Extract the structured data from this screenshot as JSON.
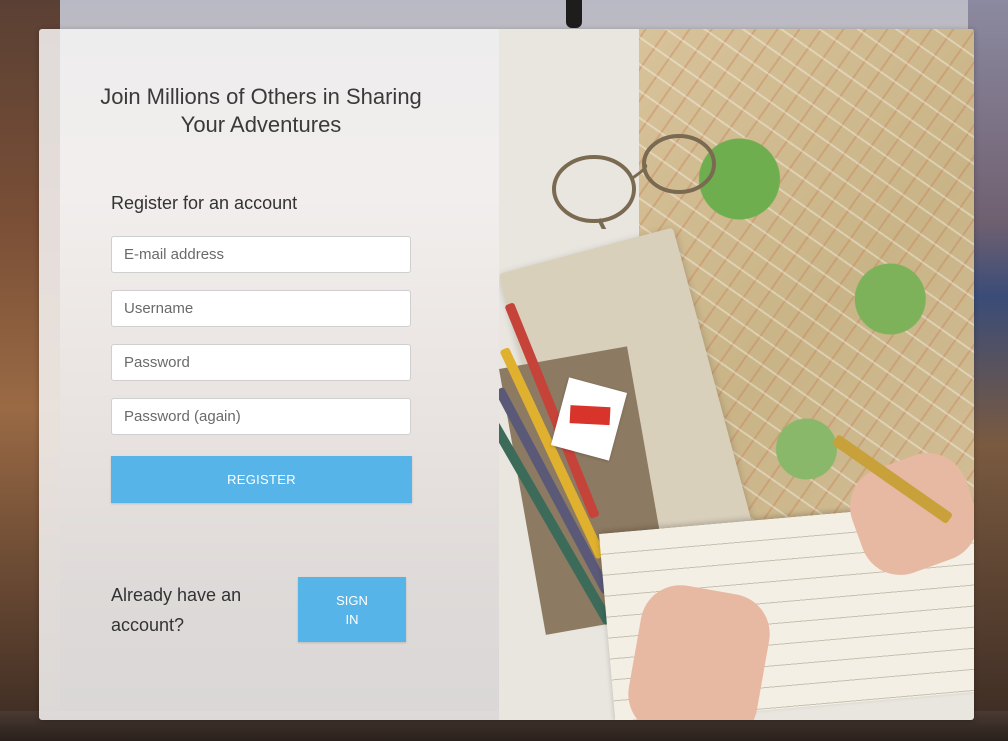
{
  "hero": {
    "headline": "Join Millions of Others in Sharing Your Adventures"
  },
  "register_form": {
    "title": "Register for an account",
    "email_placeholder": "E-mail address",
    "username_placeholder": "Username",
    "password_placeholder": "Password",
    "password_again_placeholder": "Password (again)",
    "register_label": "REGISTER"
  },
  "signin": {
    "prompt": "Already have an account?",
    "button_label": "SIGN IN"
  },
  "colors": {
    "accent": "#56b4e9",
    "panel_background": "#f6f4f5"
  },
  "photo": {
    "icon": "travel-map-photo"
  }
}
